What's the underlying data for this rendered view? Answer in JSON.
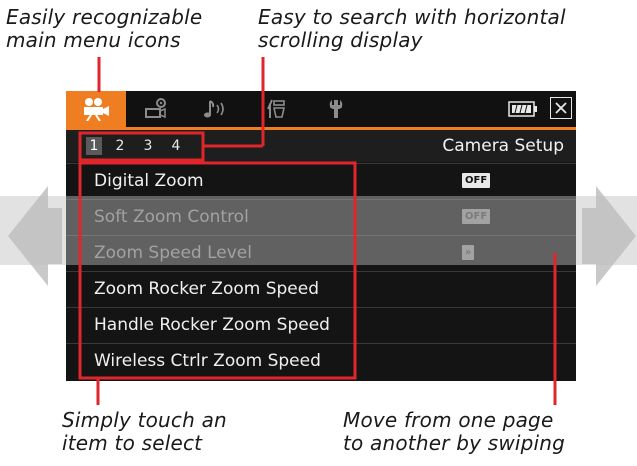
{
  "callouts": {
    "menu_icons": "Easily recognizable\nmain menu icons",
    "horizontal_scroll": "Easy to search with horizontal\nscrolling display",
    "touch_select": "Simply touch an\nitem to select",
    "swipe_pages": "Move from one page\nto another by swiping"
  },
  "menu_tabs": [
    "camera-icon",
    "recording-setup-icon",
    "audio-icon",
    "assistance-functions-icon",
    "system-setup-icon"
  ],
  "header": {
    "pages": [
      "1",
      "2",
      "3",
      "4"
    ],
    "active_page": "1",
    "title": "Camera Setup"
  },
  "menu_items": [
    {
      "label": "Digital Zoom",
      "value": "OFF"
    },
    {
      "label": "Soft Zoom Control",
      "value": "OFF"
    },
    {
      "label": "Zoom Speed Level",
      "value": "»"
    },
    {
      "label": "Zoom Rocker Zoom Speed",
      "value": ""
    },
    {
      "label": "Handle Rocker Zoom Speed",
      "value": ""
    },
    {
      "label": "Wireless Ctrlr Zoom Speed",
      "value": ""
    }
  ],
  "colors": {
    "accent": "#ef7e22",
    "highlight_box": "#e0262b",
    "swipe_band": "#bebebe"
  }
}
